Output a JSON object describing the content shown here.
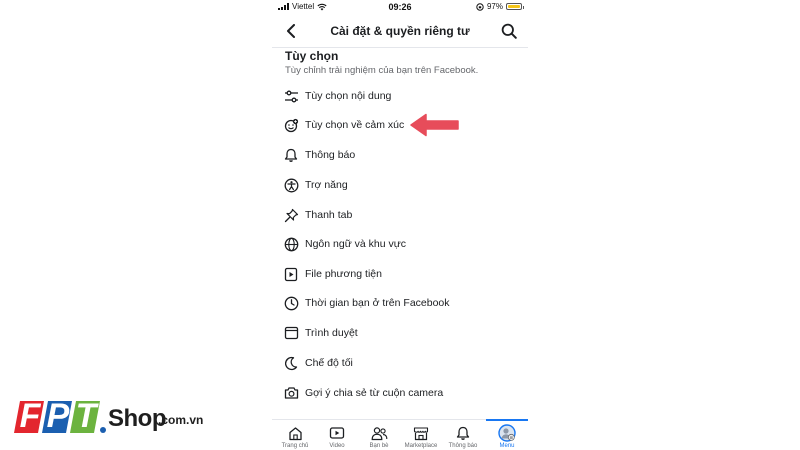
{
  "status_bar": {
    "carrier": "Viettel",
    "time": "09:26",
    "battery": "97%",
    "battery_level": 0.97
  },
  "header": {
    "title": "Cài đặt & quyền riêng tư",
    "back_icon": "back-arrow-icon",
    "search_icon": "search-icon"
  },
  "section": {
    "title": "Tùy chọn",
    "subtitle": "Tùy chỉnh trải nghiệm của bạn trên Facebook."
  },
  "menu": [
    {
      "label": "Tùy chọn nội dung",
      "icon": "sliders-icon"
    },
    {
      "label": "Tùy chọn về cảm xúc",
      "icon": "reaction-icon"
    },
    {
      "label": "Thông báo",
      "icon": "bell-icon"
    },
    {
      "label": "Trợ năng",
      "icon": "accessibility-icon"
    },
    {
      "label": "Thanh tab",
      "icon": "pin-icon"
    },
    {
      "label": "Ngôn ngữ và khu vực",
      "icon": "globe-icon"
    },
    {
      "label": "File phương tiện",
      "icon": "media-file-icon"
    },
    {
      "label": "Thời gian bạn ở trên Facebook",
      "icon": "clock-icon"
    },
    {
      "label": "Trình duyệt",
      "icon": "browser-icon"
    },
    {
      "label": "Chế độ tối",
      "icon": "moon-icon"
    },
    {
      "label": "Gợi ý chia sẻ từ cuộn camera",
      "icon": "camera-icon"
    }
  ],
  "bottom_nav": [
    {
      "label": "Trang chủ",
      "icon": "home-icon"
    },
    {
      "label": "Video",
      "icon": "video-icon"
    },
    {
      "label": "Bạn bè",
      "icon": "friends-icon"
    },
    {
      "label": "Marketplace",
      "icon": "marketplace-icon"
    },
    {
      "label": "Thông báo",
      "icon": "bell-icon"
    },
    {
      "label": "Menu",
      "icon": "avatar-icon",
      "active": true
    }
  ],
  "watermark": {
    "letters": [
      "F",
      "P",
      "T"
    ],
    "shop": "Shop",
    "domain": ".com.vn"
  },
  "colors": {
    "accent": "#1877f2",
    "arrow": "#e74c5a",
    "logo_red": "#e3262e",
    "logo_blue": "#1b5fb0",
    "logo_green": "#6cb33f"
  }
}
